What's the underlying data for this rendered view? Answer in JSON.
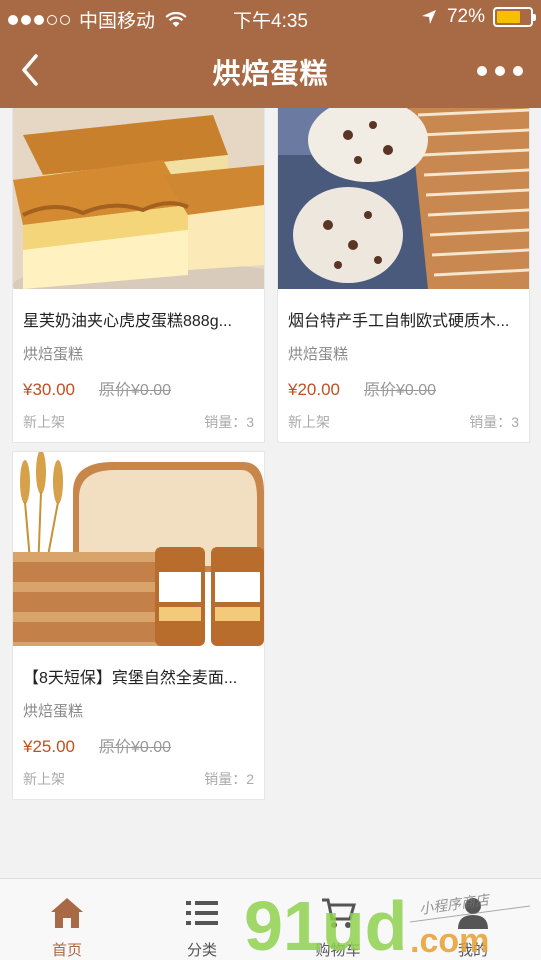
{
  "status_bar": {
    "carrier": "中国移动",
    "time": "下午4:35",
    "battery": "72%",
    "battery_level": 0.72
  },
  "nav": {
    "title": "烘焙蛋糕",
    "back_icon": "chevron-left-icon",
    "more_icon": "more-dots-icon"
  },
  "products": [
    {
      "name": "星芙奶油夹心虎皮蛋糕888g...",
      "category": "烘焙蛋糕",
      "price": "¥30.00",
      "original_price": "原价¥0.00",
      "tag": "新上架",
      "sales": "销量：3"
    },
    {
      "name": "烟台特产手工自制欧式硬质木...",
      "category": "烘焙蛋糕",
      "price": "¥20.00",
      "original_price": "原价¥0.00",
      "tag": "新上架",
      "sales": "销量：3"
    },
    {
      "name": "【8天短保】宾堡自然全麦面...",
      "category": "烘焙蛋糕",
      "price": "¥25.00",
      "original_price": "原价¥0.00",
      "tag": "新上架",
      "sales": "销量：2"
    }
  ],
  "tabs": [
    {
      "label": "首页",
      "icon": "home-icon",
      "active": true
    },
    {
      "label": "分类",
      "icon": "list-icon",
      "active": false
    },
    {
      "label": "购物车",
      "icon": "cart-icon",
      "active": false
    },
    {
      "label": "我的",
      "icon": "user-icon",
      "active": false
    }
  ],
  "watermark": {
    "text": "91ud",
    "domain": ".com",
    "handwriting": "小程序商店"
  },
  "colors": {
    "brand": "#a86a45",
    "price": "#c0501f",
    "tab_active": "#a86a45"
  }
}
